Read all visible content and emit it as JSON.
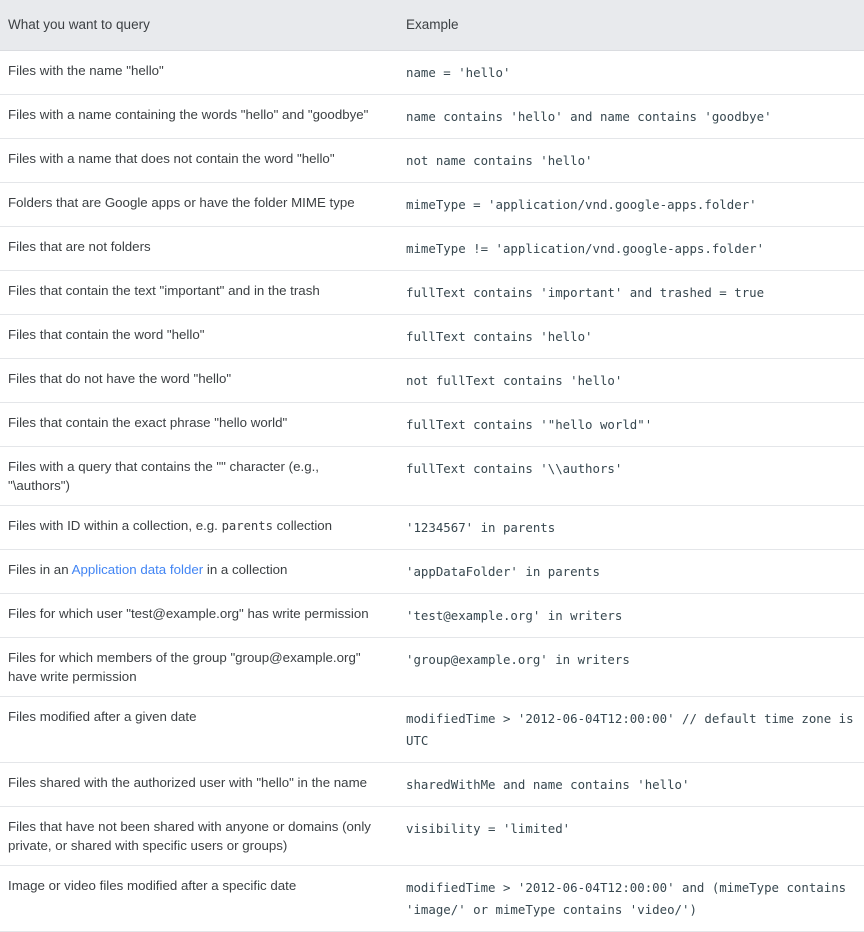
{
  "table": {
    "columns": [
      {
        "label": "What you want to query"
      },
      {
        "label": "Example"
      }
    ],
    "link_color": "#4285f4",
    "header_bg": "#e8eaed",
    "border_color": "#dadce0",
    "text_color": "#3c4043",
    "code_color": "#37474f",
    "rows": [
      {
        "desc": "Files with the name \"hello\"",
        "example": "name = 'hello'"
      },
      {
        "desc": "Files with a name containing the words \"hello\" and \"goodbye\"",
        "example": "name contains 'hello' and name contains 'goodbye'"
      },
      {
        "desc": "Files with a name that does not contain the word \"hello\"",
        "example": "not name contains 'hello'"
      },
      {
        "desc": "Folders that are Google apps or have the folder MIME type",
        "example": "mimeType = 'application/vnd.google-apps.folder'"
      },
      {
        "desc": "Files that are not folders",
        "example": "mimeType != 'application/vnd.google-apps.folder'"
      },
      {
        "desc": "Files that contain the text \"important\" and in the trash",
        "example": "fullText contains 'important' and trashed = true"
      },
      {
        "desc": "Files that contain the word \"hello\"",
        "example": "fullText contains 'hello'"
      },
      {
        "desc": "Files that do not have the word \"hello\"",
        "example": "not fullText contains 'hello'"
      },
      {
        "desc": "Files that contain the exact phrase \"hello world\"",
        "example": "fullText contains '\"hello world\"'"
      },
      {
        "desc_pre": "Files with a query that contains the \"\" character (e.g., \"\\authors\")",
        "desc": "Files with a query that contains the \"\" character (e.g., \"\\authors\")",
        "example": "fullText contains '\\\\authors'"
      },
      {
        "desc_parts": {
          "before": "Files with ID within a collection, e.g. ",
          "code": "parents",
          "after": " collection"
        },
        "example": "'1234567' in parents"
      },
      {
        "desc_link": {
          "before": "Files in an ",
          "link": "Application data folder",
          "after": " in a collection"
        },
        "example": "'appDataFolder' in parents"
      },
      {
        "desc": "Files for which user \"test@example.org\" has write permission",
        "example": "'test@example.org' in writers"
      },
      {
        "desc": "Files for which members of the group \"group@example.org\" have write permission",
        "example": "'group@example.org' in writers"
      },
      {
        "desc": "Files modified after a given date",
        "example": "modifiedTime > '2012-06-04T12:00:00' // default time zone is UTC"
      },
      {
        "desc": "Files shared with the authorized user with \"hello\" in the name",
        "example": "sharedWithMe and name contains 'hello'"
      },
      {
        "desc": "Files that have not been shared with anyone or domains (only private, or shared with specific users or groups)",
        "example": "visibility = 'limited'"
      },
      {
        "desc": "Image or video files modified after a specific date",
        "example": "modifiedTime > '2012-06-04T12:00:00' and (mimeType contains 'image/' or mimeType contains 'video/')"
      }
    ]
  }
}
